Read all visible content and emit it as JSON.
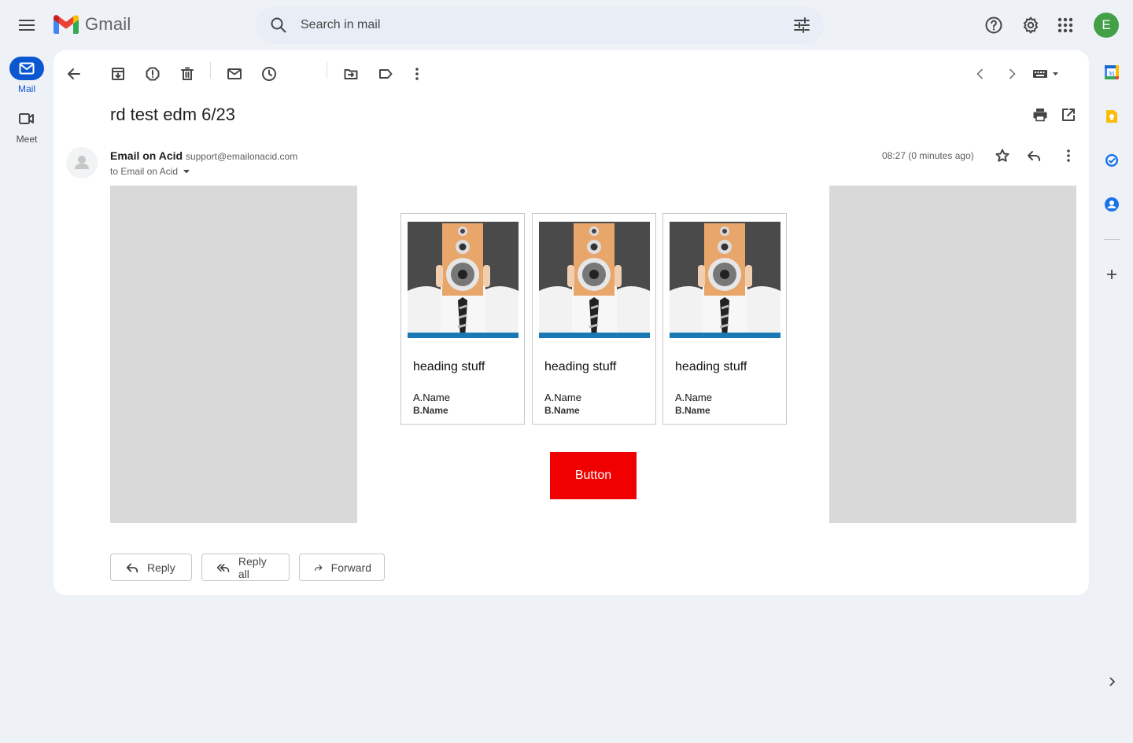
{
  "header": {
    "app_name": "Gmail",
    "search_placeholder": "Search in mail",
    "avatar_letter": "E"
  },
  "nav": {
    "items": [
      {
        "label": "Mail",
        "icon": "mail-icon",
        "active": true
      },
      {
        "label": "Meet",
        "icon": "video-icon",
        "active": false
      }
    ]
  },
  "message": {
    "subject": "rd test edm 6/23",
    "sender_name": "Email on Acid",
    "sender_email": "support@emailonacid.com",
    "to_line": "to Email on Acid",
    "timestamp": "08:27 (0 minutes ago)"
  },
  "email_content": {
    "cards": [
      {
        "heading": "heading stuff",
        "name_a": "A.Name",
        "name_b": "B.Name"
      },
      {
        "heading": "heading stuff",
        "name_a": "A.Name",
        "name_b": "B.Name"
      },
      {
        "heading": "heading stuff",
        "name_a": "A.Name",
        "name_b": "B.Name"
      }
    ],
    "button_label": "Button"
  },
  "actions": {
    "reply": "Reply",
    "reply_all": "Reply all",
    "forward": "Forward"
  },
  "colors": {
    "accent": "#0b57d0",
    "avatar_bg": "#43a047",
    "cta": "#f00000",
    "placeholder_gray": "#d9d9d9"
  }
}
